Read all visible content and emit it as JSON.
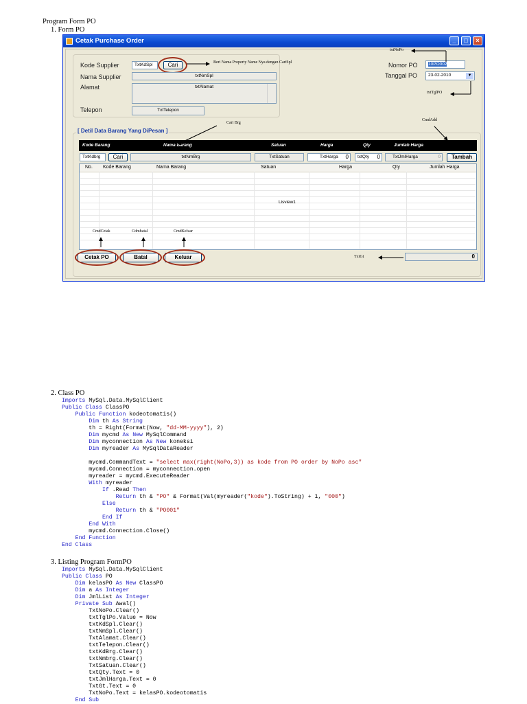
{
  "doc": {
    "heading": "Program Form PO",
    "s1": "1.   Form PO",
    "s2": "2.   Class PO",
    "s3": "3.   Listing Program FormPO"
  },
  "window": {
    "title": "Cetak Purchase Order",
    "lbl_kode_supplier": "Kode Supplier",
    "lbl_nama_supplier": "Nama Supplier",
    "lbl_alamat": "Alamat",
    "lbl_telepon": "Telepon",
    "lbl_nomor_po": "Nomor PO",
    "lbl_tanggal_po": "Tanggal PO",
    "txt_kdspl": "TxtKdSpl",
    "btn_cari": "Cari",
    "txt_nmspl": "txtNmSpl",
    "txt_alamat": "txtAlamat",
    "txt_telepon": "TxtTelepon",
    "nomor_po_value": "10PO002",
    "tanggal_po_value": "23-02-2010",
    "group_title": "[ Detil Data Barang Yang DiPesan ]",
    "hdr": [
      "Kode Barang",
      "Nama Barang",
      "Satuan",
      "Harga",
      "Qty",
      "Jumlah Harga"
    ],
    "txt_kdbrg": "TxtKdbrg",
    "btn_cari2": "Cari",
    "txt_nmbrg": "txtNmBrg",
    "txt_satuan": "TxtSatuan",
    "txt_harga": "TxtHarga",
    "txt_harga_val": "0",
    "txt_qty": "txtQty",
    "txt_qty_val": "0",
    "txt_jmlharga": "TxtJmlHarga",
    "txt_jmlharga_val": "0",
    "btn_tambah": "Tambah",
    "lv_cols": [
      "No.",
      "Kode Barang",
      "Nama Barang",
      "Satuan",
      "Harga",
      "Qty",
      "Jumlah Harga"
    ],
    "lv_name": "Lisview1",
    "btn_cetak": "Cetak PO",
    "btn_batal": "Batal",
    "btn_keluar": "Keluar",
    "txt_gt_val": "0"
  },
  "notes": {
    "n_property": "Beri Nama Property Name Nya dengan CariSpl",
    "n_txtnopo": "txtNoPo",
    "n_txttglpo": "txtTglPO",
    "n_cmdadd": "CmdAdd",
    "n_caribrg": "Cari Brg",
    "n_cmdcetak": "CmdCetak",
    "n_cdmbatal": "Cdmbatal",
    "n_cmdkeluar": "CmdKeluar",
    "n_txtgt": "TxtGt"
  },
  "code_class": [
    [
      [
        "kw",
        "Imports"
      ],
      [
        "t",
        " MySql.Data.MySqlClient"
      ]
    ],
    [
      [
        "kw",
        "Public Class"
      ],
      [
        "t",
        " ClassPO"
      ]
    ],
    [
      [
        "t",
        "    "
      ],
      [
        "kw",
        "Public Function"
      ],
      [
        "t",
        " kodeotomatis()"
      ]
    ],
    [
      [
        "t",
        "        "
      ],
      [
        "kw",
        "Dim"
      ],
      [
        "t",
        " th "
      ],
      [
        "kw",
        "As String"
      ]
    ],
    [
      [
        "t",
        "        th = Right(Format(Now, "
      ],
      [
        "str",
        "\"dd-MM-yyyy\""
      ],
      [
        "t",
        "), 2)"
      ]
    ],
    [
      [
        "t",
        "        "
      ],
      [
        "kw",
        "Dim"
      ],
      [
        "t",
        " mycmd "
      ],
      [
        "kw",
        "As New"
      ],
      [
        "t",
        " MySqlCommand"
      ]
    ],
    [
      [
        "t",
        "        "
      ],
      [
        "kw",
        "Dim"
      ],
      [
        "t",
        " myconnection "
      ],
      [
        "kw",
        "As New"
      ],
      [
        "t",
        " koneksi"
      ]
    ],
    [
      [
        "t",
        "        "
      ],
      [
        "kw",
        "Dim"
      ],
      [
        "t",
        " myreader "
      ],
      [
        "kw",
        "As"
      ],
      [
        "t",
        " MySqlDataReader"
      ]
    ],
    [
      [
        "t",
        ""
      ]
    ],
    [
      [
        "t",
        "        mycmd.CommandText = "
      ],
      [
        "str",
        "\"select max(right(NoPo,3)) as kode from PO order by NoPo asc\""
      ]
    ],
    [
      [
        "t",
        "        mycmd.Connection = myconnection.open"
      ]
    ],
    [
      [
        "t",
        "        myreader = mycmd.ExecuteReader"
      ]
    ],
    [
      [
        "t",
        "        "
      ],
      [
        "kw",
        "With"
      ],
      [
        "t",
        " myreader"
      ]
    ],
    [
      [
        "t",
        "            "
      ],
      [
        "kw",
        "If"
      ],
      [
        "t",
        " .Read "
      ],
      [
        "kw",
        "Then"
      ]
    ],
    [
      [
        "t",
        "                "
      ],
      [
        "kw",
        "Return"
      ],
      [
        "t",
        " th & "
      ],
      [
        "str",
        "\"PO\""
      ],
      [
        "t",
        " & Format(Val(myreader("
      ],
      [
        "str",
        "\"kode\""
      ],
      [
        "t",
        ").ToString) + 1, "
      ],
      [
        "str",
        "\"000\""
      ],
      [
        "t",
        ")"
      ]
    ],
    [
      [
        "t",
        "            "
      ],
      [
        "kw",
        "Else"
      ]
    ],
    [
      [
        "t",
        "                "
      ],
      [
        "kw",
        "Return"
      ],
      [
        "t",
        " th & "
      ],
      [
        "str",
        "\"PO001\""
      ]
    ],
    [
      [
        "t",
        "            "
      ],
      [
        "kw",
        "End If"
      ]
    ],
    [
      [
        "t",
        "        "
      ],
      [
        "kw",
        "End With"
      ]
    ],
    [
      [
        "t",
        "        mycmd.Connection.Close()"
      ]
    ],
    [
      [
        "t",
        "    "
      ],
      [
        "kw",
        "End Function"
      ]
    ],
    [
      [
        "kw",
        "End Class"
      ]
    ]
  ],
  "code_form": [
    [
      [
        "kw",
        "Imports"
      ],
      [
        "t",
        " MySql.Data.MySqlClient"
      ]
    ],
    [
      [
        "kw",
        "Public Class"
      ],
      [
        "t",
        " PO"
      ]
    ],
    [
      [
        "t",
        "    "
      ],
      [
        "kw",
        "Dim"
      ],
      [
        "t",
        " kelasPO "
      ],
      [
        "kw",
        "As New"
      ],
      [
        "t",
        " ClassPO"
      ]
    ],
    [
      [
        "t",
        "    "
      ],
      [
        "kw",
        "Dim"
      ],
      [
        "t",
        " a "
      ],
      [
        "kw",
        "As Integer"
      ]
    ],
    [
      [
        "t",
        "    "
      ],
      [
        "kw",
        "Dim"
      ],
      [
        "t",
        " JmlList "
      ],
      [
        "kw",
        "As Integer"
      ]
    ],
    [
      [
        "t",
        "    "
      ],
      [
        "kw",
        "Private Sub"
      ],
      [
        "t",
        " Awal()"
      ]
    ],
    [
      [
        "t",
        "        TxtNoPo.Clear()"
      ]
    ],
    [
      [
        "t",
        "        txtTglPo.Value = Now"
      ]
    ],
    [
      [
        "t",
        "        txtKdSpl.Clear()"
      ]
    ],
    [
      [
        "t",
        "        txtNmSpl.Clear()"
      ]
    ],
    [
      [
        "t",
        "        TxtAlamat.Clear()"
      ]
    ],
    [
      [
        "t",
        "        txtTelepon.Clear()"
      ]
    ],
    [
      [
        "t",
        "        txtKdBrg.Clear()"
      ]
    ],
    [
      [
        "t",
        "        txtNmbrg.Clear()"
      ]
    ],
    [
      [
        "t",
        "        TxtSatuan.Clear()"
      ]
    ],
    [
      [
        "t",
        "        txtQty.Text = 0"
      ]
    ],
    [
      [
        "t",
        "        txtJmlHarga.Text = 0"
      ]
    ],
    [
      [
        "t",
        "        TxtGt.Text = 0"
      ]
    ],
    [
      [
        "t",
        "        TxtNoPo.Text = kelasPO.kodeotomatis"
      ]
    ],
    [
      [
        "t",
        "    "
      ],
      [
        "kw",
        "End Sub"
      ]
    ]
  ]
}
